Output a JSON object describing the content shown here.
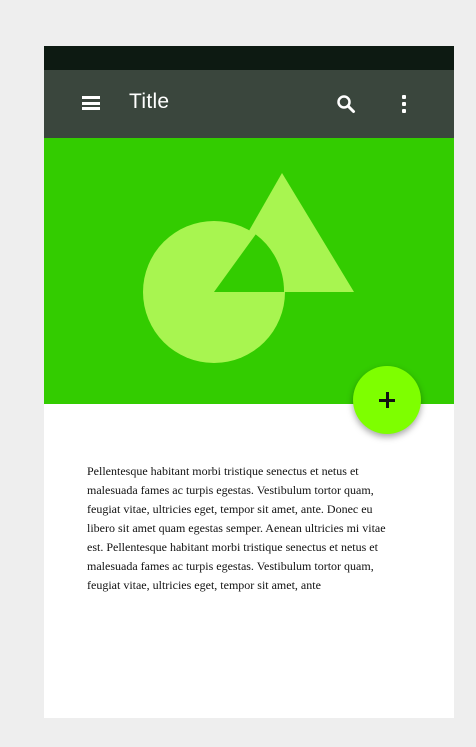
{
  "app_bar": {
    "title": "Title",
    "menu_icon": "menu-icon",
    "search_icon": "search-icon",
    "more_icon": "more-vert-icon"
  },
  "hero": {
    "background": "#33cc00",
    "shape_color": "#a8f550"
  },
  "fab": {
    "icon": "add-icon",
    "color": "#7eff00"
  },
  "content": {
    "body": "Pellentesque habitant morbi tristique senectus et netus et malesuada fames ac turpis egestas. Vestibulum tortor quam, feugiat vitae, ultricies eget, tempor sit amet, ante. Donec eu libero sit amet quam egestas semper. Aenean ultricies mi vitae est. Pellentesque habitant morbi tristique senectus et netus et malesuada fames ac turpis egestas. Vestibulum tortor quam, feugiat vitae, ultricies eget, tempor sit amet, ante"
  }
}
